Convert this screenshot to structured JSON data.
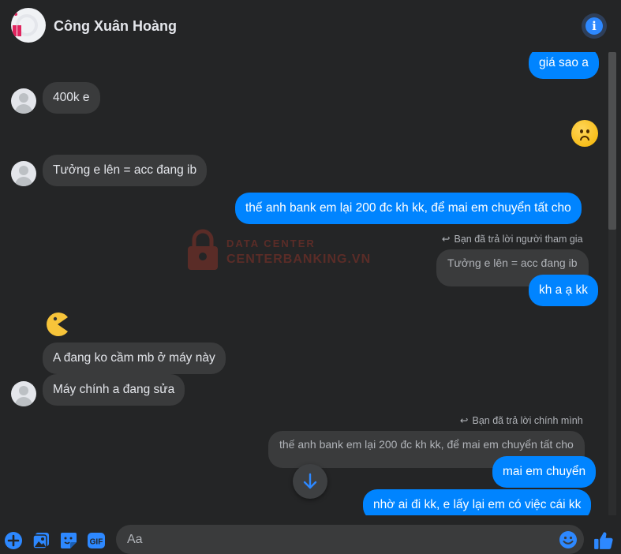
{
  "header": {
    "name": "Công Xuân Hoàng"
  },
  "messages": {
    "m0": "giá sao a",
    "m1": "400k e",
    "m2": "Tưởng e lên = acc đang ib",
    "m3": "thế anh bank em lại 200 đc kh kk, để mai em chuyển tất cho",
    "note1": "Bạn đã trả lời người tham gia",
    "quote1": "Tưởng e lên = acc đang ib",
    "m4": "kh a ạ kk",
    "m5": "A đang ko cầm mb ở máy này",
    "m6": "Máy chính a đang sửa",
    "note2": "Bạn đã trả lời chính mình",
    "quote2": "thế anh bank em lại 200 đc kh kk, để mai em chuyển tất cho",
    "m7": "mai em chuyển",
    "m8": "nhờ ai đi kk, e lấy lại em có việc cái kk"
  },
  "watermark": {
    "line1": "DATA CENTER",
    "line2": "CENTERBANKING.VN"
  },
  "composer": {
    "placeholder": "Aa"
  },
  "icons": {
    "info": "info-icon",
    "add": "plus-circle-icon",
    "photo": "photo-icon",
    "sticker": "sticker-icon",
    "gif": "gif-icon",
    "emoji": "emoji-icon",
    "like": "thumbs-up-icon",
    "scroll": "arrow-down-icon"
  },
  "colors": {
    "accent": "#0084ff",
    "icon_blue": "#2d88ff",
    "bg": "#242526",
    "incoming": "#3a3b3c"
  }
}
